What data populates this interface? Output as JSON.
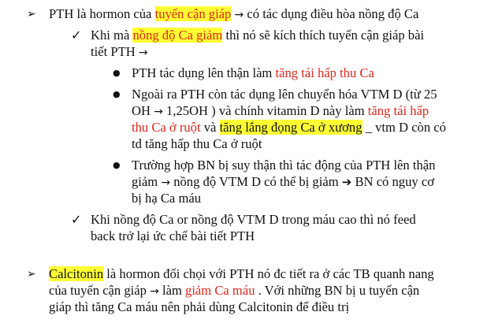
{
  "icons": {
    "section_marker": "➢",
    "sub_marker": "✓",
    "bullet_marker": "●",
    "arrow": "→",
    "bold_arrow": "➔"
  },
  "colors": {
    "red_text": "#e0261c",
    "highlight": "#ffff33"
  },
  "section1": {
    "line1": {
      "t1": "PTH là hormon của ",
      "t2": "tuyến cận giáp",
      "t3": " có tác dụng điều hòa nồng độ Ca"
    },
    "sub1": {
      "line1": {
        "t1": "Khi mà ",
        "t2": "nồng độ Ca giảm",
        "t3": " thì nó sẽ kích thích tuyến cận giáp bài"
      },
      "line2": {
        "t1": "tiết PTH "
      },
      "bullet1": {
        "t1": "PTH tác dụng lên thận làm ",
        "t2": "tăng tái hấp thu Ca"
      },
      "bullet2": {
        "line1": {
          "t1": "Ngoài ra PTH còn tác dụng lên chuyển hóa VTM D (từ 25"
        },
        "line2": {
          "t1": "OH ",
          "t2": " 1,25OH ) và chính vitamin D này làm ",
          "t3": "tăng tái hấp"
        },
        "line3": {
          "t1": "thu Ca ở ruột",
          "t2": " và ",
          "t3": "tăng lắng đọng Ca ở xương",
          "t4": " _ vtm D còn có"
        },
        "line4": {
          "t1": "td tăng hấp thu Ca ở ruột"
        }
      },
      "bullet3": {
        "line1": {
          "t1": "Trường hợp BN bị suy thận thì tác động của PTH lên thận"
        },
        "line2": {
          "t1": "giảm ",
          "t2": " nồng độ VTM D có thể bị giảm ",
          "t3": " BN có nguy cơ"
        },
        "line3": {
          "t1": "bị hạ Ca máu"
        }
      }
    },
    "sub2": {
      "line1": {
        "t1": "Khi nồng độ Ca or nồng độ VTM D trong máu cao thì nó feed"
      },
      "line2": {
        "t1": "back trở lại ức chế bài tiết PTH"
      }
    }
  },
  "section2": {
    "line1": {
      "t1": "Calcitonin",
      "t2": " là hormon đối chọi với PTH nó đc tiết ra ở các TB quanh nang"
    },
    "line2": {
      "t1": "của tuyến cận giáp ",
      "t2": " làm ",
      "t3": "giảm Ca máu",
      "t4": " . Với những BN bị u tuyến cận"
    },
    "line3": {
      "t1": "giáp thì tăng Ca máu nên phải dùng Calcitonin để điều trị"
    }
  }
}
